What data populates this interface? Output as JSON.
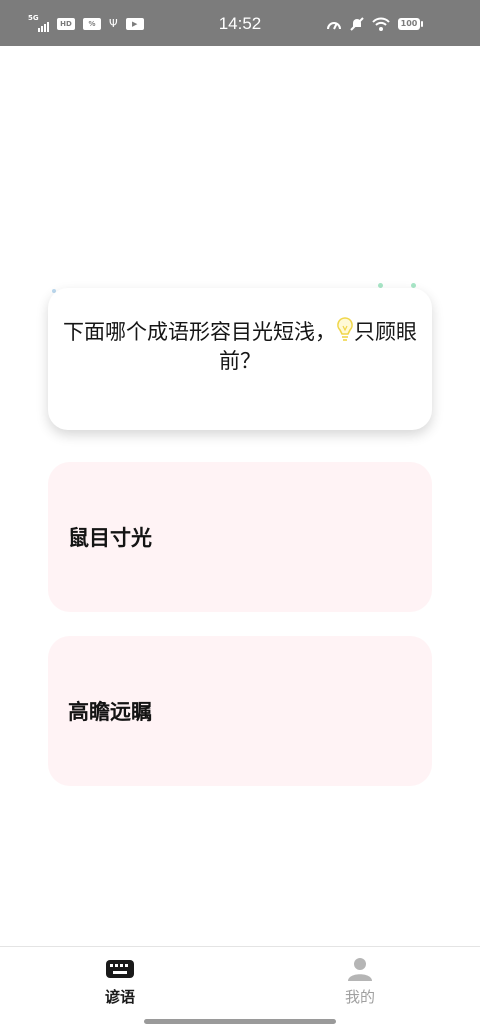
{
  "status_bar": {
    "network_label": "5G",
    "hd_label": "HD",
    "time": "14:52",
    "battery": "100",
    "icons": [
      "signal-icon",
      "hd-icon",
      "data-icon",
      "usb-icon",
      "play-icon",
      "speed-icon",
      "mute-icon",
      "wifi-icon",
      "battery-icon"
    ]
  },
  "question": {
    "text_before_icon": "下面哪个成语形容目光短浅，",
    "text_after_icon": "只顾眼前？",
    "icon": "lightbulb-icon"
  },
  "options": [
    {
      "label": "鼠目寸光"
    },
    {
      "label": "高瞻远瞩"
    }
  ],
  "tabs": [
    {
      "label": "谚语",
      "icon": "keyboard-icon",
      "active": true
    },
    {
      "label": "我的",
      "icon": "user-icon",
      "active": false
    }
  ],
  "colors": {
    "status_bar": "#7c7c7c",
    "option_background": "#fff3f5",
    "tab_active": "#1a1a1a",
    "tab_inactive": "#a0a0a0",
    "bulb": "#f0d64a"
  }
}
